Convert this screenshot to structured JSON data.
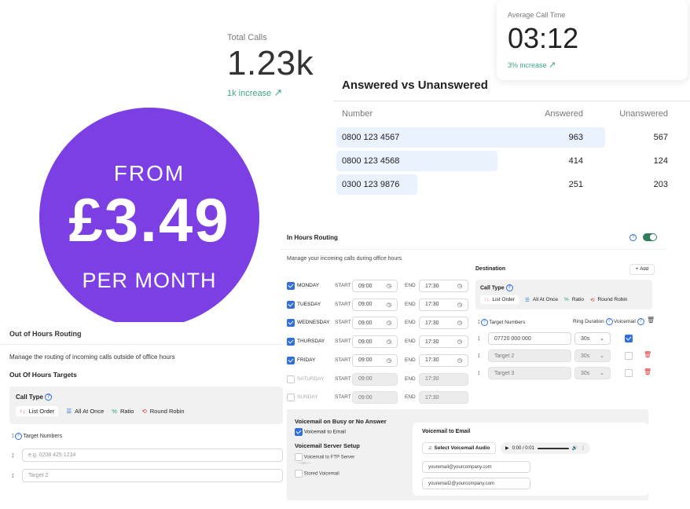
{
  "total_calls": {
    "label": "Total Calls",
    "value": "1.23k",
    "trend": "1k increase"
  },
  "avg_call": {
    "label": "Average Call Time",
    "value": "03:12",
    "trend": "3% increase"
  },
  "answered_table": {
    "title": "Answered vs Unanswered",
    "headers": [
      "Number",
      "Answered",
      "Unanswered"
    ],
    "rows": [
      {
        "number": "0800 123 4567",
        "answered": "963",
        "unanswered": "567",
        "bar": 1.0
      },
      {
        "number": "0800 123 4568",
        "answered": "414",
        "unanswered": "124",
        "bar": 0.6
      },
      {
        "number": "0300 123 9876",
        "answered": "251",
        "unanswered": "203",
        "bar": 0.3
      }
    ]
  },
  "promo": {
    "from": "FROM",
    "price": "£3.49",
    "per": "PER MONTH",
    "color": "#7b3fe4"
  },
  "in_hours": {
    "title": "In Hours Routing",
    "subtitle": "Manage your incoming calls during office hours",
    "start_label": "START",
    "end_label": "END",
    "days": [
      {
        "name": "MONDAY",
        "on": true,
        "start": "09:00",
        "end": "17:30"
      },
      {
        "name": "TUESDAY",
        "on": true,
        "start": "09:00",
        "end": "17:30"
      },
      {
        "name": "WEDNESDAY",
        "on": true,
        "start": "09:00",
        "end": "17:30"
      },
      {
        "name": "THURSDAY",
        "on": true,
        "start": "09:00",
        "end": "17:30"
      },
      {
        "name": "FRIDAY",
        "on": true,
        "start": "09:00",
        "end": "17:30"
      },
      {
        "name": "SATURDAY",
        "on": false,
        "start": "09:00",
        "end": "17:30"
      },
      {
        "name": "SUNDAY",
        "on": false,
        "start": "09:00",
        "end": "17:30"
      }
    ],
    "destination": {
      "title": "Destination",
      "add": "Add",
      "call_type": "Call Type",
      "options": [
        "List Order",
        "All At Once",
        "Ratio",
        "Round Robin"
      ],
      "target_numbers": "Target Numbers",
      "ring_duration": "Ring Duration",
      "voicemail": "Voicemail",
      "targets": [
        {
          "value": "07720 000 000",
          "placeholder": "",
          "ring": "30s",
          "vm": true,
          "enabled": true
        },
        {
          "value": "",
          "placeholder": "Target 2",
          "ring": "30s",
          "vm": false,
          "enabled": false
        },
        {
          "value": "",
          "placeholder": "Target 3",
          "ring": "30s",
          "vm": false,
          "enabled": false
        }
      ]
    },
    "voicemail_panel": {
      "title": "Voicemail on Busy or No Answer",
      "to_email": "Voicemail to Email",
      "server_setup": "Voicemail Server Setup",
      "to_ftp": "Voicemail to FTP Server",
      "or": "—or—",
      "stored": "Stored Voicemail",
      "card_title": "Voicemail to Email",
      "select_audio": "Select Voicemail Audio",
      "audio_time": "0:00 / 0:01",
      "emails": [
        "youremail@yourcompany.com",
        "youremail2@yourcompany.com"
      ]
    }
  },
  "out_hours": {
    "title": "Out of Hours Routing",
    "subtitle": "Manage the routing of incoming calls outside of office hours",
    "targets_title": "Out Of Hours Targets",
    "call_type": "Call Type",
    "options": [
      "List Order",
      "All At Once",
      "Ratio",
      "Round Robin"
    ],
    "target_numbers": "Target Numbers",
    "placeholders": [
      "e.g. 0208 425 1234",
      "Target 2"
    ]
  }
}
